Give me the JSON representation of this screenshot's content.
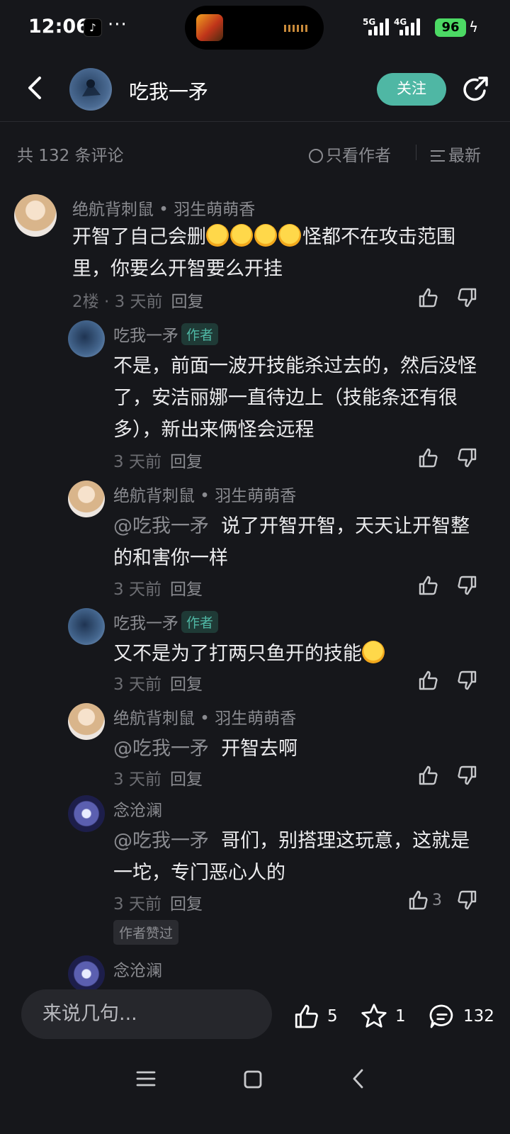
{
  "status": {
    "time": "12:06",
    "notif_app": "♪",
    "more": "···",
    "net1": "5G",
    "net2": "4G",
    "battery": "96"
  },
  "header": {
    "title": "吃我一矛",
    "follow_label": "关注"
  },
  "comments_bar": {
    "count_text": "共 132 条评论",
    "author_only": "只看作者",
    "sort_label": "最新"
  },
  "comments": [
    {
      "user": "绝航背刺鼠 • 羽生萌萌香",
      "text_a": "开智了自己会删",
      "text_b": "怪都不在攻击范围里，你要么开智要么开挂",
      "floor": "2楼",
      "time": "· 3 天前",
      "reply": "回复"
    }
  ],
  "replies": [
    {
      "user": "吃我一矛",
      "tag": "作者",
      "text": "不是，前面一波开技能杀过去的，然后没怪了，安洁丽娜一直待边上（技能条还有很多），新出来俩怪会远程",
      "time": "3 天前",
      "reply": "回复"
    },
    {
      "user": "绝航背刺鼠 • 羽生萌萌香",
      "at": "@吃我一矛",
      "text": "说了开智开智，天天让开智整的和害你一样",
      "time": "3 天前",
      "reply": "回复"
    },
    {
      "user": "吃我一矛",
      "tag": "作者",
      "text": "又不是为了打两只鱼开的技能",
      "time": "3 天前",
      "reply": "回复"
    },
    {
      "user": "绝航背刺鼠 • 羽生萌萌香",
      "at": "@吃我一矛",
      "text": "开智去啊",
      "time": "3 天前",
      "reply": "回复"
    },
    {
      "user": "念沧澜",
      "at": "@吃我一矛",
      "text": "哥们，别搭理这玩意，这就是一坨，专门恶心人的",
      "time": "3 天前",
      "reply": "回复",
      "likes": "3",
      "liked_label": "作者赞过"
    },
    {
      "user": "念沧澜"
    }
  ],
  "bottom": {
    "placeholder": "来说几句...",
    "likes": "5",
    "favorites": "1",
    "comments": "132"
  },
  "colors": {
    "accent": "#4fb7a4",
    "background": "#16171b"
  },
  "icons": [
    "back-icon",
    "share-icon",
    "thumb-up-icon",
    "thumb-down-icon",
    "star-icon",
    "comment-icon",
    "menu-icon",
    "home-icon",
    "nav-back-icon"
  ]
}
